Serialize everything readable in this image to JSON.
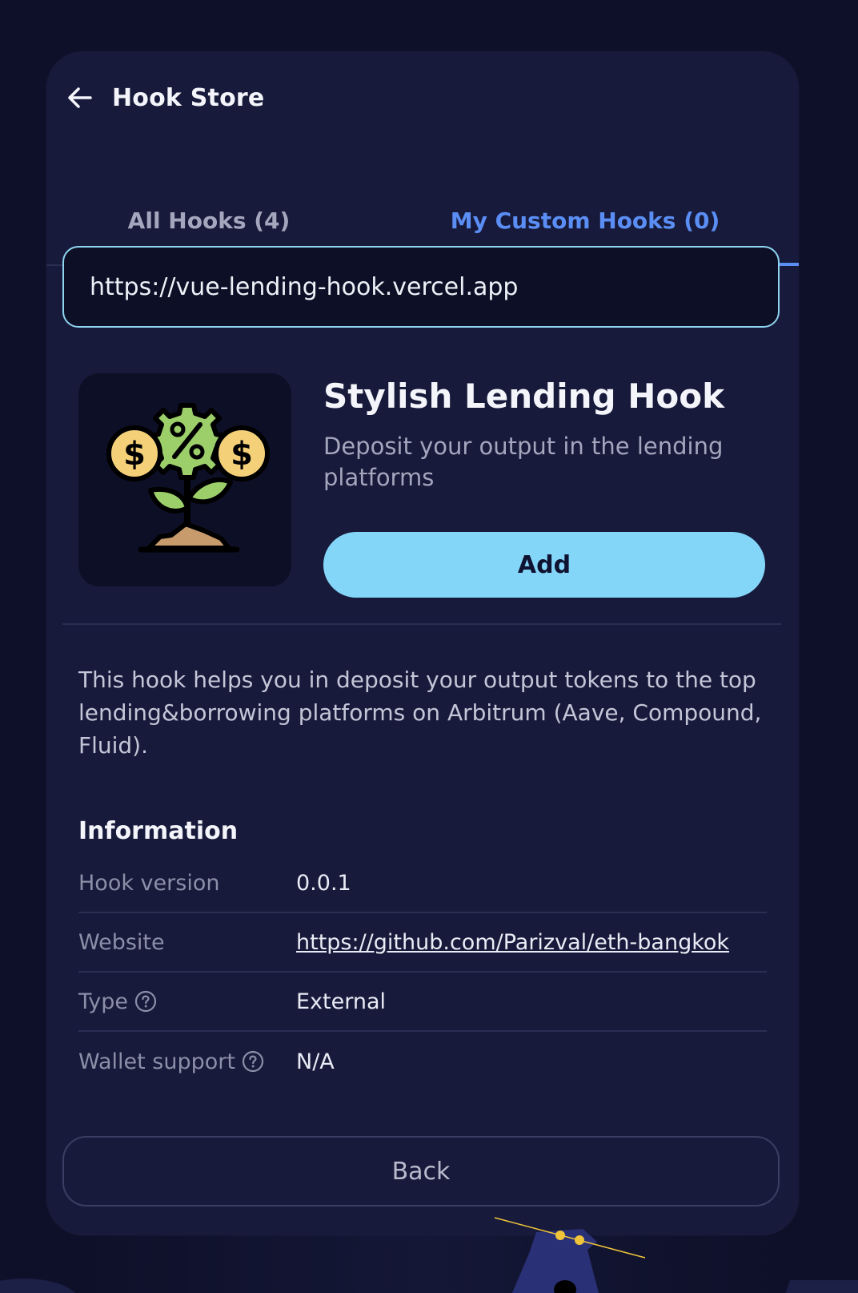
{
  "header": {
    "title": "Hook Store",
    "back_icon": "arrow-left-icon"
  },
  "tabs": [
    {
      "label": "All Hooks (4)",
      "active": false
    },
    {
      "label": "My Custom Hooks (0)",
      "active": true
    }
  ],
  "url_input": {
    "value": "https://vue-lending-hook.vercel.app",
    "placeholder": ""
  },
  "hook": {
    "image_icon": "money-plant-icon",
    "title": "Stylish Lending Hook",
    "subtitle": "Deposit your output in the lending platforms",
    "add_label": "Add"
  },
  "description": "This hook helps you in deposit your output tokens to the top lending&borrowing platforms on Arbitrum (Aave, Compound, Fluid).",
  "information": {
    "heading": "Information",
    "rows": [
      {
        "label": "Hook version",
        "value": "0.0.1"
      },
      {
        "label": "Website",
        "value": "https://github.com/Parizval/eth-bangkok"
      },
      {
        "label": "Type",
        "value": "External"
      },
      {
        "label": "Wallet support",
        "value": "N/A"
      }
    ]
  },
  "footer": {
    "back_label": "Back"
  },
  "colors": {
    "background": "#0e1029",
    "panel": "#171a3a",
    "accent": "#5b8ef5",
    "add_button": "#84d6f9",
    "input_border": "#8fd4ef"
  }
}
